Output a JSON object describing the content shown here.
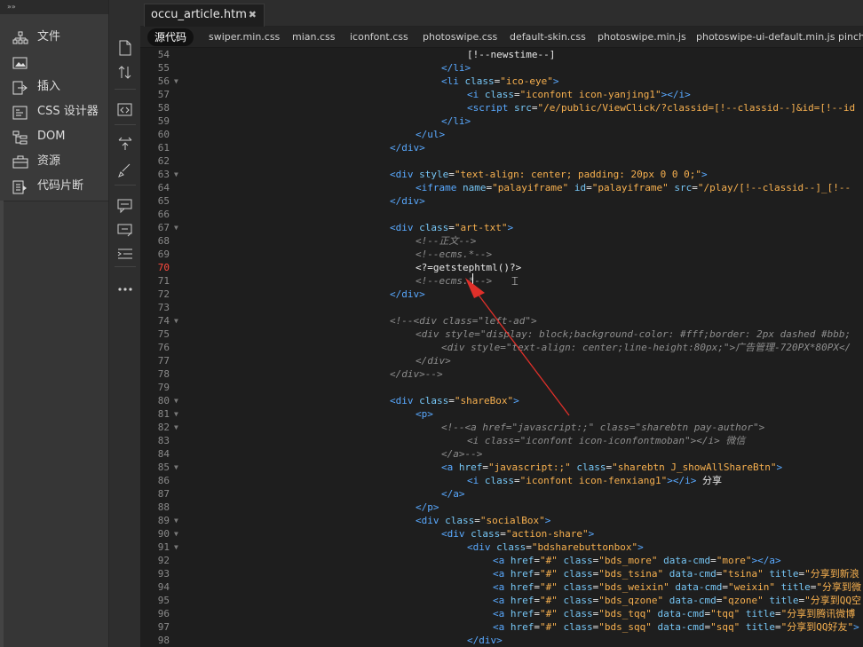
{
  "app": {
    "left_toggle": "»»"
  },
  "panels": [
    {
      "id": "files",
      "label": "文件",
      "icon": "files-tree-icon"
    },
    {
      "id": "assets-img",
      "label": "",
      "icon": "image-icon"
    },
    {
      "id": "insert",
      "label": "插入",
      "icon": "insert-icon"
    },
    {
      "id": "css",
      "label": "CSS 设计器",
      "icon": "css-designer-icon"
    },
    {
      "id": "dom",
      "label": "DOM",
      "icon": "dom-tree-icon"
    },
    {
      "id": "assets",
      "label": "资源",
      "icon": "briefcase-icon"
    },
    {
      "id": "snippets",
      "label": "代码片断",
      "icon": "snippets-icon"
    }
  ],
  "tools": [
    "file-management-icon",
    "sort-icon",
    "wrap-tag-icon",
    "expand-icon",
    "brush-icon",
    "comment-icon",
    "highlight-icon",
    "indent-icon",
    "more-icon"
  ],
  "tab": {
    "title": "occu_article.htm",
    "close": "✖"
  },
  "related_files": [
    "源代码",
    "swiper.min.css",
    "mian.css",
    "iconfont.css",
    "photoswipe.css",
    "default-skin.css",
    "photoswipe.min.js",
    "photoswipe-ui-default.min.js",
    "pinchz"
  ],
  "code_lines": [
    {
      "n": "54",
      "fold": false,
      "ind": 16,
      "tokens": [
        [
          "p",
          "[!--newstime--]"
        ]
      ]
    },
    {
      "n": "55",
      "fold": false,
      "ind": 12,
      "tokens": [
        [
          "t",
          "</li>"
        ]
      ]
    },
    {
      "n": "56",
      "fold": true,
      "ind": 12,
      "tokens": [
        [
          "t",
          "<li "
        ],
        [
          "a",
          "class"
        ],
        [
          "p",
          "="
        ],
        [
          "s",
          "\"ico-eye\""
        ],
        [
          "t",
          ">"
        ]
      ]
    },
    {
      "n": "57",
      "fold": false,
      "ind": 16,
      "tokens": [
        [
          "t",
          "<i "
        ],
        [
          "a",
          "class"
        ],
        [
          "p",
          "="
        ],
        [
          "s",
          "\"iconfont icon-yanjing1\""
        ],
        [
          "t",
          "></i>"
        ]
      ]
    },
    {
      "n": "58",
      "fold": false,
      "ind": 16,
      "tokens": [
        [
          "t",
          "<script "
        ],
        [
          "a",
          "src"
        ],
        [
          "p",
          "="
        ],
        [
          "s",
          "\"/e/public/ViewClick/?classid=[!--classid--]&id=[!--id"
        ]
      ]
    },
    {
      "n": "59",
      "fold": false,
      "ind": 12,
      "tokens": [
        [
          "t",
          "</li>"
        ]
      ]
    },
    {
      "n": "60",
      "fold": false,
      "ind": 8,
      "tokens": [
        [
          "t",
          "</ul>"
        ]
      ]
    },
    {
      "n": "61",
      "fold": false,
      "ind": 4,
      "tokens": [
        [
          "t",
          "</div>"
        ]
      ]
    },
    {
      "n": "62",
      "fold": false,
      "ind": 0,
      "tokens": []
    },
    {
      "n": "63",
      "fold": true,
      "ind": 4,
      "tokens": [
        [
          "t",
          "<div "
        ],
        [
          "a",
          "style"
        ],
        [
          "p",
          "="
        ],
        [
          "s",
          "\"text-align: center; padding: 20px 0 0 0;\""
        ],
        [
          "t",
          ">"
        ]
      ]
    },
    {
      "n": "64",
      "fold": false,
      "ind": 8,
      "tokens": [
        [
          "t",
          "<iframe "
        ],
        [
          "a",
          "name"
        ],
        [
          "p",
          "="
        ],
        [
          "s",
          "\"palayiframe\""
        ],
        [
          "p",
          " "
        ],
        [
          "a",
          "id"
        ],
        [
          "p",
          "="
        ],
        [
          "s",
          "\"palayiframe\""
        ],
        [
          "p",
          " "
        ],
        [
          "a",
          "src"
        ],
        [
          "p",
          "="
        ],
        [
          "s",
          "\"/play/[!--classid--]_[!--"
        ]
      ]
    },
    {
      "n": "65",
      "fold": false,
      "ind": 4,
      "tokens": [
        [
          "t",
          "</div>"
        ]
      ]
    },
    {
      "n": "66",
      "fold": false,
      "ind": 0,
      "tokens": []
    },
    {
      "n": "67",
      "fold": true,
      "ind": 4,
      "tokens": [
        [
          "t",
          "<div "
        ],
        [
          "a",
          "class"
        ],
        [
          "p",
          "="
        ],
        [
          "s",
          "\"art-txt\""
        ],
        [
          "t",
          ">"
        ]
      ]
    },
    {
      "n": "68",
      "fold": false,
      "ind": 8,
      "tokens": [
        [
          "c",
          "<!--正文-->"
        ]
      ]
    },
    {
      "n": "69",
      "fold": false,
      "ind": 8,
      "tokens": [
        [
          "c",
          "<!--ecms.*-->"
        ]
      ]
    },
    {
      "n": "70",
      "fold": false,
      "ind": 8,
      "err": true,
      "tokens": [
        [
          "p",
          "<?=getstephtml()?>"
        ]
      ]
    },
    {
      "n": "71",
      "fold": false,
      "ind": 8,
      "tokens": [
        [
          "c",
          "<!--ecms.*-->"
        ]
      ]
    },
    {
      "n": "72",
      "fold": false,
      "ind": 4,
      "tokens": [
        [
          "t",
          "</div>"
        ]
      ]
    },
    {
      "n": "73",
      "fold": false,
      "ind": 0,
      "tokens": []
    },
    {
      "n": "74",
      "fold": true,
      "ind": 4,
      "tokens": [
        [
          "c",
          "<!--<div class=\"left-ad\">"
        ]
      ]
    },
    {
      "n": "75",
      "fold": false,
      "ind": 8,
      "tokens": [
        [
          "c",
          "<div style=\"display: block;background-color: #fff;border: 2px dashed #bbb;"
        ]
      ]
    },
    {
      "n": "76",
      "fold": false,
      "ind": 12,
      "tokens": [
        [
          "c",
          "<div style=\"text-align: center;line-height:80px;\">广告管理-720PX*80PX</"
        ]
      ]
    },
    {
      "n": "77",
      "fold": false,
      "ind": 8,
      "tokens": [
        [
          "c",
          "</div>"
        ]
      ]
    },
    {
      "n": "78",
      "fold": false,
      "ind": 4,
      "tokens": [
        [
          "c",
          "</div>-->"
        ]
      ]
    },
    {
      "n": "79",
      "fold": false,
      "ind": 0,
      "tokens": []
    },
    {
      "n": "80",
      "fold": true,
      "ind": 4,
      "tokens": [
        [
          "t",
          "<div "
        ],
        [
          "a",
          "class"
        ],
        [
          "p",
          "="
        ],
        [
          "s",
          "\"shareBox\""
        ],
        [
          "t",
          ">"
        ]
      ]
    },
    {
      "n": "81",
      "fold": true,
      "ind": 8,
      "tokens": [
        [
          "t",
          "<p>"
        ]
      ]
    },
    {
      "n": "82",
      "fold": true,
      "ind": 12,
      "tokens": [
        [
          "c",
          "<!--<a href=\"javascript:;\" class=\"sharebtn pay-author\">"
        ]
      ]
    },
    {
      "n": "83",
      "fold": false,
      "ind": 16,
      "tokens": [
        [
          "c",
          "<i class=\"iconfont icon-iconfontmoban\"></i> 微信"
        ]
      ]
    },
    {
      "n": "84",
      "fold": false,
      "ind": 12,
      "tokens": [
        [
          "c",
          "</a>-->"
        ]
      ]
    },
    {
      "n": "85",
      "fold": true,
      "ind": 12,
      "tokens": [
        [
          "t",
          "<a "
        ],
        [
          "a",
          "href"
        ],
        [
          "p",
          "="
        ],
        [
          "s",
          "\"javascript:;\""
        ],
        [
          "p",
          " "
        ],
        [
          "a",
          "class"
        ],
        [
          "p",
          "="
        ],
        [
          "s",
          "\"sharebtn J_showAllShareBtn\""
        ],
        [
          "t",
          ">"
        ]
      ]
    },
    {
      "n": "86",
      "fold": false,
      "ind": 16,
      "tokens": [
        [
          "t",
          "<i "
        ],
        [
          "a",
          "class"
        ],
        [
          "p",
          "="
        ],
        [
          "s",
          "\"iconfont icon-fenxiang1\""
        ],
        [
          "t",
          "></i>"
        ],
        [
          "p",
          " 分享"
        ]
      ]
    },
    {
      "n": "87",
      "fold": false,
      "ind": 12,
      "tokens": [
        [
          "t",
          "</a>"
        ]
      ]
    },
    {
      "n": "88",
      "fold": false,
      "ind": 8,
      "tokens": [
        [
          "t",
          "</p>"
        ]
      ]
    },
    {
      "n": "89",
      "fold": true,
      "ind": 8,
      "tokens": [
        [
          "t",
          "<div "
        ],
        [
          "a",
          "class"
        ],
        [
          "p",
          "="
        ],
        [
          "s",
          "\"socialBox\""
        ],
        [
          "t",
          ">"
        ]
      ]
    },
    {
      "n": "90",
      "fold": true,
      "ind": 12,
      "tokens": [
        [
          "t",
          "<div "
        ],
        [
          "a",
          "class"
        ],
        [
          "p",
          "="
        ],
        [
          "s",
          "\"action-share\""
        ],
        [
          "t",
          ">"
        ]
      ]
    },
    {
      "n": "91",
      "fold": true,
      "ind": 16,
      "tokens": [
        [
          "t",
          "<div "
        ],
        [
          "a",
          "class"
        ],
        [
          "p",
          "="
        ],
        [
          "s",
          "\"bdsharebuttonbox\""
        ],
        [
          "t",
          ">"
        ]
      ]
    },
    {
      "n": "92",
      "fold": false,
      "ind": 20,
      "tokens": [
        [
          "t",
          "<a "
        ],
        [
          "a",
          "href"
        ],
        [
          "p",
          "="
        ],
        [
          "s",
          "\"#\""
        ],
        [
          "p",
          " "
        ],
        [
          "a",
          "class"
        ],
        [
          "p",
          "="
        ],
        [
          "s",
          "\"bds_more\""
        ],
        [
          "p",
          " "
        ],
        [
          "a",
          "data-cmd"
        ],
        [
          "p",
          "="
        ],
        [
          "s",
          "\"more\""
        ],
        [
          "t",
          "></a>"
        ]
      ]
    },
    {
      "n": "93",
      "fold": false,
      "ind": 20,
      "tokens": [
        [
          "t",
          "<a "
        ],
        [
          "a",
          "href"
        ],
        [
          "p",
          "="
        ],
        [
          "s",
          "\"#\""
        ],
        [
          "p",
          " "
        ],
        [
          "a",
          "class"
        ],
        [
          "p",
          "="
        ],
        [
          "s",
          "\"bds_tsina\""
        ],
        [
          "p",
          " "
        ],
        [
          "a",
          "data-cmd"
        ],
        [
          "p",
          "="
        ],
        [
          "s",
          "\"tsina\""
        ],
        [
          "p",
          " "
        ],
        [
          "a",
          "title"
        ],
        [
          "p",
          "="
        ],
        [
          "s",
          "\"分享到新浪"
        ]
      ]
    },
    {
      "n": "94",
      "fold": false,
      "ind": 20,
      "tokens": [
        [
          "t",
          "<a "
        ],
        [
          "a",
          "href"
        ],
        [
          "p",
          "="
        ],
        [
          "s",
          "\"#\""
        ],
        [
          "p",
          " "
        ],
        [
          "a",
          "class"
        ],
        [
          "p",
          "="
        ],
        [
          "s",
          "\"bds_weixin\""
        ],
        [
          "p",
          " "
        ],
        [
          "a",
          "data-cmd"
        ],
        [
          "p",
          "="
        ],
        [
          "s",
          "\"weixin\""
        ],
        [
          "p",
          " "
        ],
        [
          "a",
          "title"
        ],
        [
          "p",
          "="
        ],
        [
          "s",
          "\"分享到微"
        ]
      ]
    },
    {
      "n": "95",
      "fold": false,
      "ind": 20,
      "tokens": [
        [
          "t",
          "<a "
        ],
        [
          "a",
          "href"
        ],
        [
          "p",
          "="
        ],
        [
          "s",
          "\"#\""
        ],
        [
          "p",
          " "
        ],
        [
          "a",
          "class"
        ],
        [
          "p",
          "="
        ],
        [
          "s",
          "\"bds_qzone\""
        ],
        [
          "p",
          " "
        ],
        [
          "a",
          "data-cmd"
        ],
        [
          "p",
          "="
        ],
        [
          "s",
          "\"qzone\""
        ],
        [
          "p",
          " "
        ],
        [
          "a",
          "title"
        ],
        [
          "p",
          "="
        ],
        [
          "s",
          "\"分享到QQ空"
        ]
      ]
    },
    {
      "n": "96",
      "fold": false,
      "ind": 20,
      "tokens": [
        [
          "t",
          "<a "
        ],
        [
          "a",
          "href"
        ],
        [
          "p",
          "="
        ],
        [
          "s",
          "\"#\""
        ],
        [
          "p",
          " "
        ],
        [
          "a",
          "class"
        ],
        [
          "p",
          "="
        ],
        [
          "s",
          "\"bds_tqq\""
        ],
        [
          "p",
          " "
        ],
        [
          "a",
          "data-cmd"
        ],
        [
          "p",
          "="
        ],
        [
          "s",
          "\"tqq\""
        ],
        [
          "p",
          " "
        ],
        [
          "a",
          "title"
        ],
        [
          "p",
          "="
        ],
        [
          "s",
          "\"分享到腾讯微博"
        ]
      ]
    },
    {
      "n": "97",
      "fold": false,
      "ind": 20,
      "tokens": [
        [
          "t",
          "<a "
        ],
        [
          "a",
          "href"
        ],
        [
          "p",
          "="
        ],
        [
          "s",
          "\"#\""
        ],
        [
          "p",
          " "
        ],
        [
          "a",
          "class"
        ],
        [
          "p",
          "="
        ],
        [
          "s",
          "\"bds_sqq\""
        ],
        [
          "p",
          " "
        ],
        [
          "a",
          "data-cmd"
        ],
        [
          "p",
          "="
        ],
        [
          "s",
          "\"sqq\""
        ],
        [
          "p",
          " "
        ],
        [
          "a",
          "title"
        ],
        [
          "p",
          "="
        ],
        [
          "s",
          "\"分享到QQ好友\""
        ],
        [
          "t",
          ">"
        ]
      ]
    },
    {
      "n": "98",
      "fold": false,
      "ind": 16,
      "tokens": [
        [
          "t",
          "</div>"
        ]
      ]
    }
  ],
  "colors": {
    "tag": "#59a9ff",
    "attr": "#76c6f5",
    "string": "#f7b04f",
    "comment": "#8e8e8e",
    "error_line": "#ff4a3d",
    "annotation_arrow": "#e0302a"
  }
}
